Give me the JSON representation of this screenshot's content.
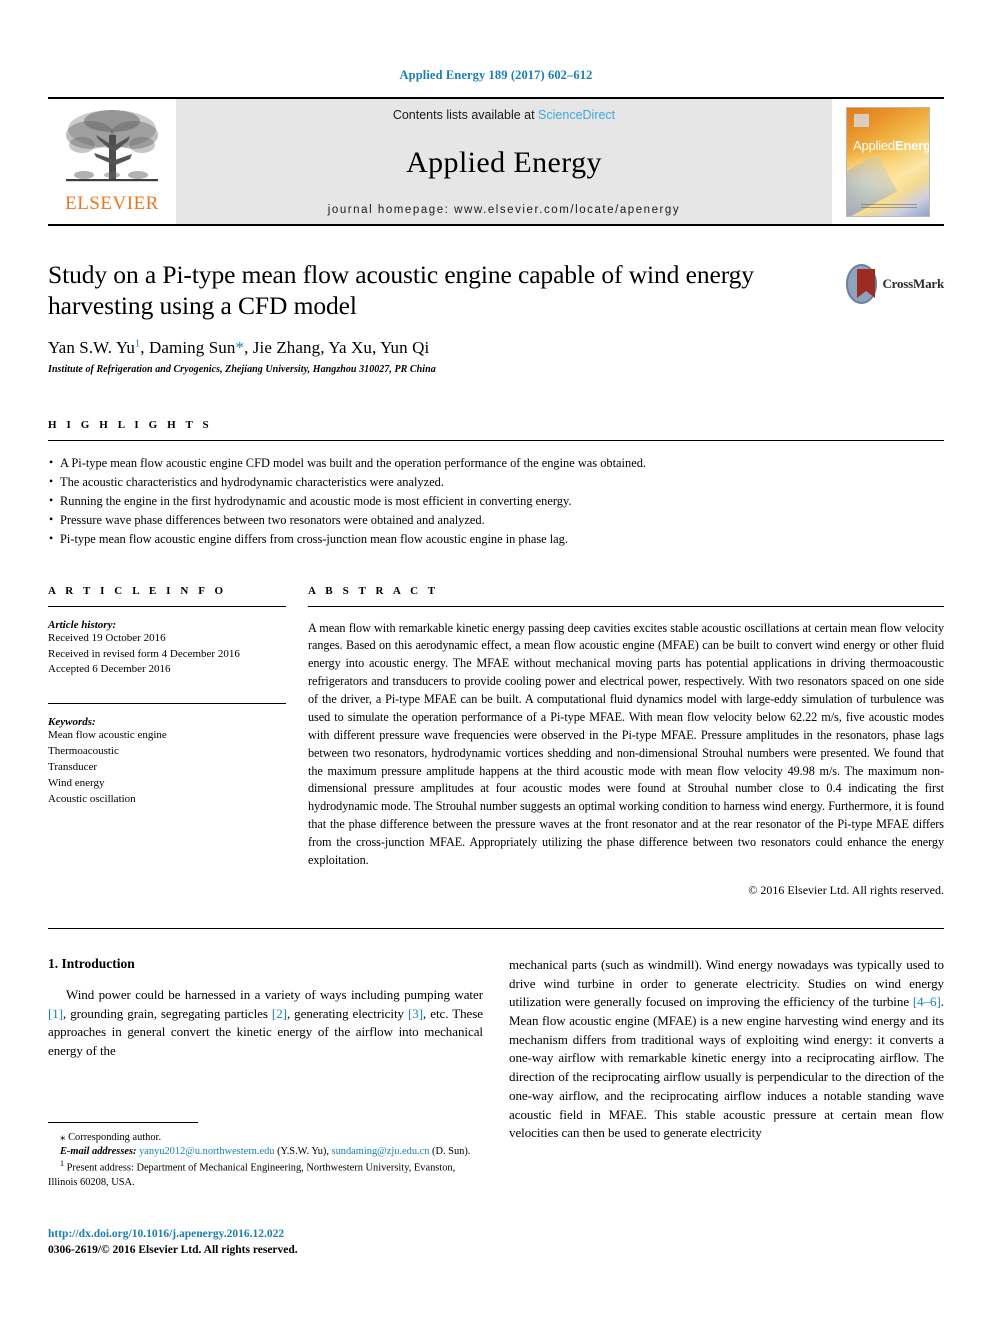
{
  "running_head": "Applied Energy 189 (2017) 602–612",
  "masthead": {
    "publisher_name": "ELSEVIER",
    "contents_prefix": "Contents lists available at ",
    "sciencedirect": "ScienceDirect",
    "journal_title": "Applied Energy",
    "homepage": "journal homepage: www.elsevier.com/locate/apenergy",
    "cover_title_a": "Applied",
    "cover_title_b": "Energy",
    "link_color": "#3fa8dc",
    "brand_color": "#E87722"
  },
  "article": {
    "title": "Study on a Pi-type mean flow acoustic engine capable of wind energy harvesting using a CFD model",
    "authors_html": "Yan S.W. Yu, Daming Sun, Jie Zhang, Ya Xu, Yun Qi",
    "author_list": [
      {
        "name": "Yan S.W. Yu",
        "marker": "1"
      },
      {
        "name": "Daming Sun",
        "marker": "*"
      },
      {
        "name": "Jie Zhang",
        "marker": ""
      },
      {
        "name": "Ya Xu",
        "marker": ""
      },
      {
        "name": "Yun Qi",
        "marker": ""
      }
    ],
    "affiliation": "Institute of Refrigeration and Cryogenics, Zhejiang University, Hangzhou 310027, PR China",
    "crossmark_label": "CrossMark"
  },
  "highlights": {
    "heading": "H I G H L I G H T S",
    "items": [
      "A Pi-type mean flow acoustic engine CFD model was built and the operation performance of the engine was obtained.",
      "The acoustic characteristics and hydrodynamic characteristics were analyzed.",
      "Running the engine in the first hydrodynamic and acoustic mode is most efficient in converting energy.",
      "Pressure wave phase differences between two resonators were obtained and analyzed.",
      "Pi-type mean flow acoustic engine differs from cross-junction mean flow acoustic engine in phase lag."
    ]
  },
  "article_info": {
    "heading": "A R T I C L E    I N F O",
    "history_label": "Article history:",
    "history": [
      "Received 19 October 2016",
      "Received in revised form 4 December 2016",
      "Accepted 6 December 2016"
    ],
    "keywords_label": "Keywords:",
    "keywords": [
      "Mean flow acoustic engine",
      "Thermoacoustic",
      "Transducer",
      "Wind energy",
      "Acoustic oscillation"
    ]
  },
  "abstract": {
    "heading": "A B S T R A C T",
    "text": "A mean flow with remarkable kinetic energy passing deep cavities excites stable acoustic oscillations at certain mean flow velocity ranges. Based on this aerodynamic effect, a mean flow acoustic engine (MFAE) can be built to convert wind energy or other fluid energy into acoustic energy. The MFAE without mechanical moving parts has potential applications in driving thermoacoustic refrigerators and transducers to provide cooling power and electrical power, respectively. With two resonators spaced on one side of the driver, a Pi-type MFAE can be built. A computational fluid dynamics model with large-eddy simulation of turbulence was used to simulate the operation performance of a Pi-type MFAE. With mean flow velocity below 62.22 m/s, five acoustic modes with different pressure wave frequencies were observed in the Pi-type MFAE. Pressure amplitudes in the resonators, phase lags between two resonators, hydrodynamic vortices shedding and non-dimensional Strouhal numbers were presented. We found that the maximum pressure amplitude happens at the third acoustic mode with mean flow velocity 49.98 m/s. The maximum non-dimensional pressure amplitudes at four acoustic modes were found at Strouhal number close to 0.4 indicating the first hydrodynamic mode. The Strouhal number suggests an optimal working condition to harness wind energy. Furthermore, it is found that the phase difference between the pressure waves at the front resonator and at the rear resonator of the Pi-type MFAE differs from the cross-junction MFAE. Appropriately utilizing the phase difference between two resonators could enhance the energy exploitation.",
    "copyright": "© 2016 Elsevier Ltd. All rights reserved."
  },
  "introduction": {
    "heading": "1. Introduction",
    "left_paragraph_pre": "Wind power could be harnessed in a variety of ways including pumping water ",
    "cite1": "[1]",
    "left_mid1": ", grounding grain, segregating particles ",
    "cite2": "[2]",
    "left_mid2": ", generating electricity ",
    "cite3": "[3]",
    "left_tail": ", etc. These approaches in general convert the kinetic energy of the airflow into mechanical energy of the",
    "right_pre": "mechanical parts (such as windmill). Wind energy nowadays was typically used to drive wind turbine in order to generate electricity. Studies on wind energy utilization were generally focused on improving the efficiency of the turbine ",
    "cite46": "[4–6]",
    "right_tail": ". Mean flow acoustic engine (MFAE) is a new engine harvesting wind energy and its mechanism differs from traditional ways of exploiting wind energy: it converts a one-way airflow with remarkable kinetic energy into a reciprocating airflow. The direction of the reciprocating airflow usually is perpendicular to the direction of the one-way airflow, and the reciprocating airflow induces a notable standing wave acoustic field in MFAE. This stable acoustic pressure at certain mean flow velocities can then be used to generate electricity"
  },
  "footnotes": {
    "corresponding": "Corresponding author.",
    "email_label": "E-mail addresses:",
    "email1": "yanyu2012@u.northwestern.edu",
    "email1_owner": " (Y.S.W. Yu), ",
    "email2": "sundaming@zju.edu.cn",
    "email2_owner": " (D. Sun).",
    "present_address": "Present address: Department of Mechanical Engineering, Northwestern University, Evanston, Illinois 60208, USA.",
    "doi": "http://dx.doi.org/10.1016/j.apenergy.2016.12.022",
    "issn": "0306-2619/© 2016 Elsevier Ltd. All rights reserved."
  }
}
